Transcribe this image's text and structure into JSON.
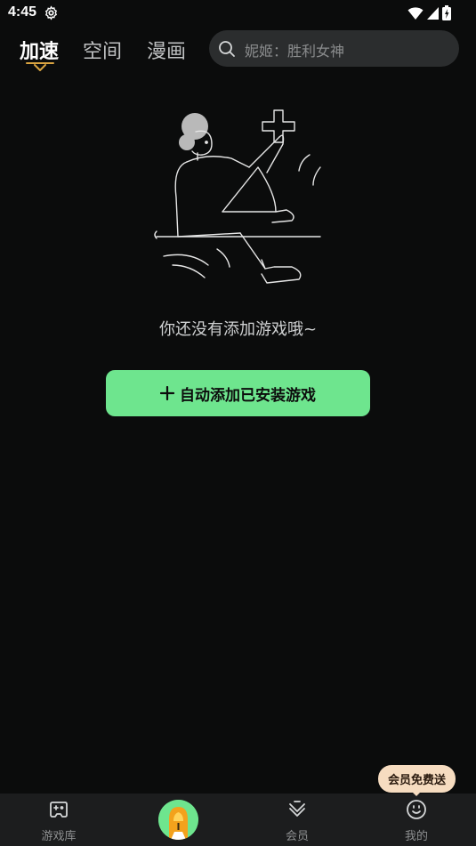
{
  "status_bar": {
    "time": "4:45",
    "icons": [
      "settings-gear-icon",
      "wifi-icon",
      "cellular-signal-icon",
      "battery-icon"
    ]
  },
  "header": {
    "tabs": [
      {
        "label": "加速",
        "active": true
      },
      {
        "label": "空间",
        "active": false
      },
      {
        "label": "漫画",
        "active": false
      }
    ],
    "search": {
      "placeholder": "妮姬：胜利女神",
      "icon": "search-icon"
    }
  },
  "empty_state": {
    "illustration": "person-holding-plus-illustration",
    "message": "你还没有添加游戏哦~",
    "button_label": "自动添加已安装游戏",
    "button_icon": "plus-icon"
  },
  "bottom_nav": {
    "items": [
      {
        "label": "游戏库",
        "icon": "gamepad-icon"
      },
      {
        "label": "",
        "icon": "boost-center-icon"
      },
      {
        "label": "会员",
        "icon": "vip-diamond-icon"
      },
      {
        "label": "我的",
        "icon": "smile-face-icon"
      }
    ],
    "vip_badge": "会员免费送"
  },
  "colors": {
    "background": "#0b0c0c",
    "accent_green": "#6ee58e",
    "search_bg": "#2b2d2e",
    "nav_bg": "#1c1d1e",
    "badge_bg": "#f6dcc0",
    "indicator_gold": "#d9a441"
  }
}
